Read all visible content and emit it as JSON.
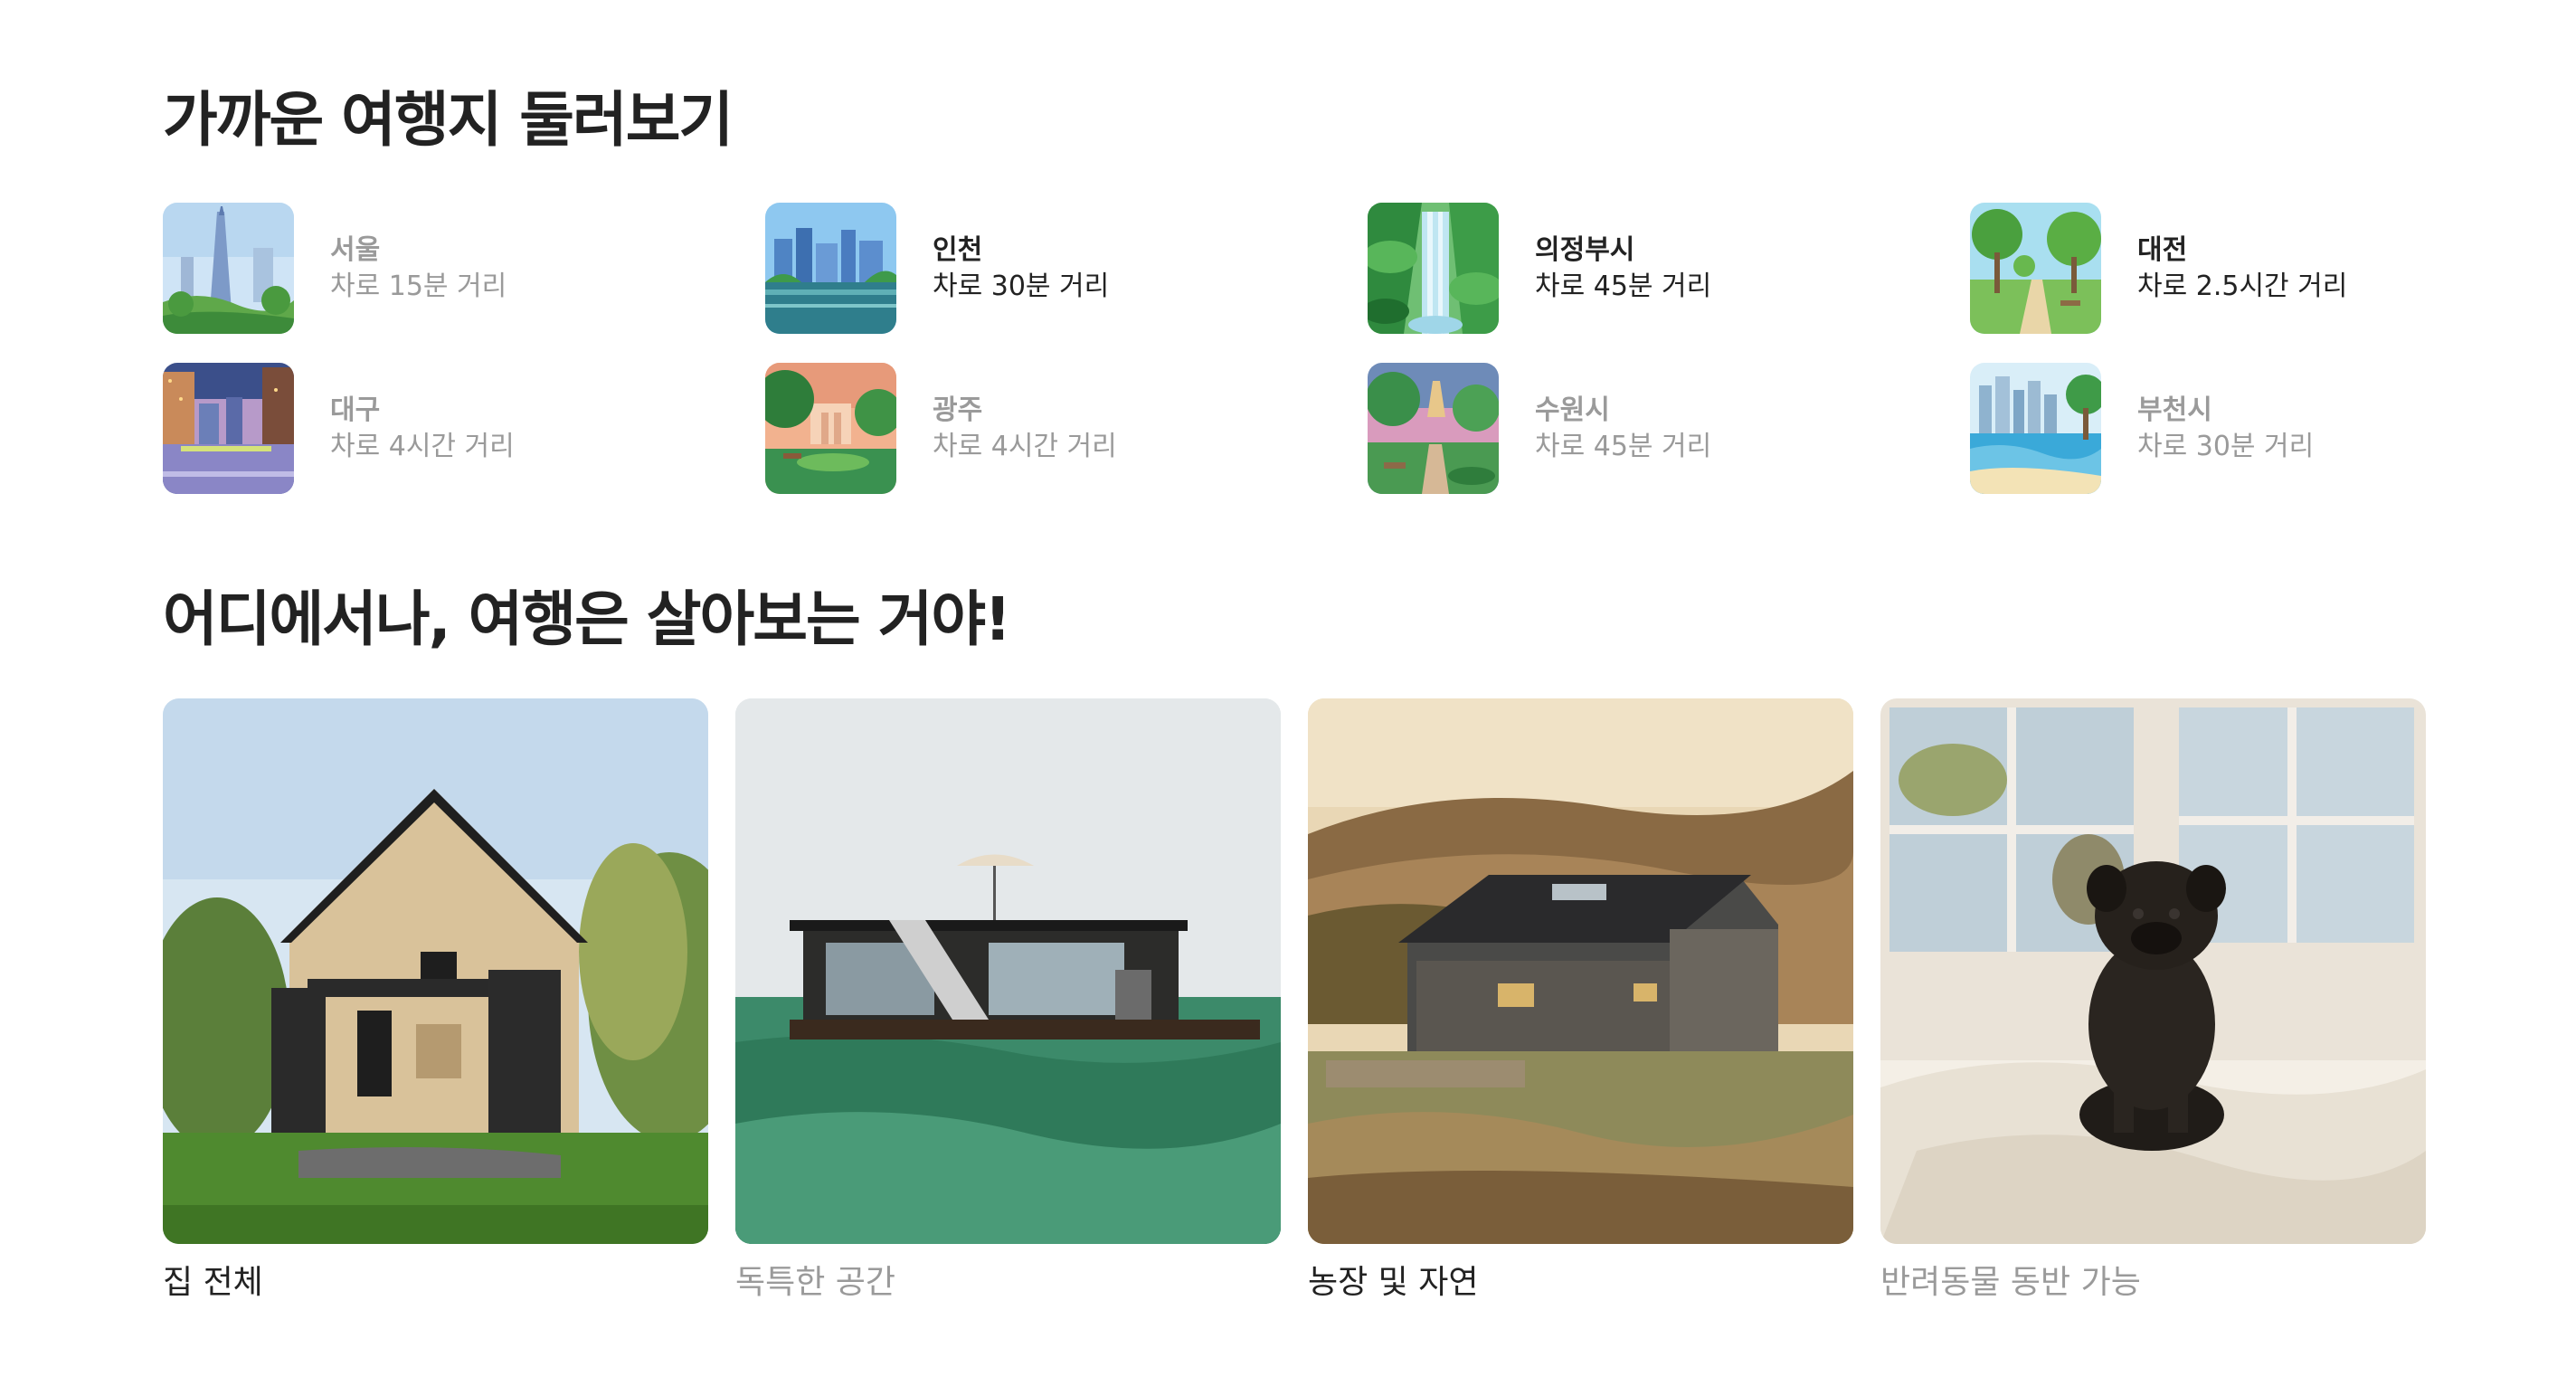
{
  "sections": {
    "nearby_title": "가까운 여행지 둘러보기",
    "anywhere_title": "어디에서나, 여행은 살아보는 거야!"
  },
  "destinations": [
    {
      "name": "서울",
      "distance": "차로 15분 거리",
      "state": "dim"
    },
    {
      "name": "인천",
      "distance": "차로 30분 거리",
      "state": "active"
    },
    {
      "name": "의정부시",
      "distance": "차로 45분 거리",
      "state": "active"
    },
    {
      "name": "대전",
      "distance": "차로 2.5시간 거리",
      "state": "active"
    },
    {
      "name": "대구",
      "distance": "차로 4시간 거리",
      "state": "dim"
    },
    {
      "name": "광주",
      "distance": "차로 4시간 거리",
      "state": "dim"
    },
    {
      "name": "수원시",
      "distance": "차로 45분 거리",
      "state": "dim"
    },
    {
      "name": "부천시",
      "distance": "차로 30분 거리",
      "state": "dim"
    }
  ],
  "categories": [
    {
      "label": "집 전체",
      "state": "active"
    },
    {
      "label": "독특한 공간",
      "state": "dim"
    },
    {
      "label": "농장 및 자연",
      "state": "active"
    },
    {
      "label": "반려동물 동반 가능",
      "state": "dim"
    }
  ],
  "colors": {
    "text_primary": "#222222",
    "text_muted": "#9a9a9a",
    "background": "#ffffff"
  }
}
